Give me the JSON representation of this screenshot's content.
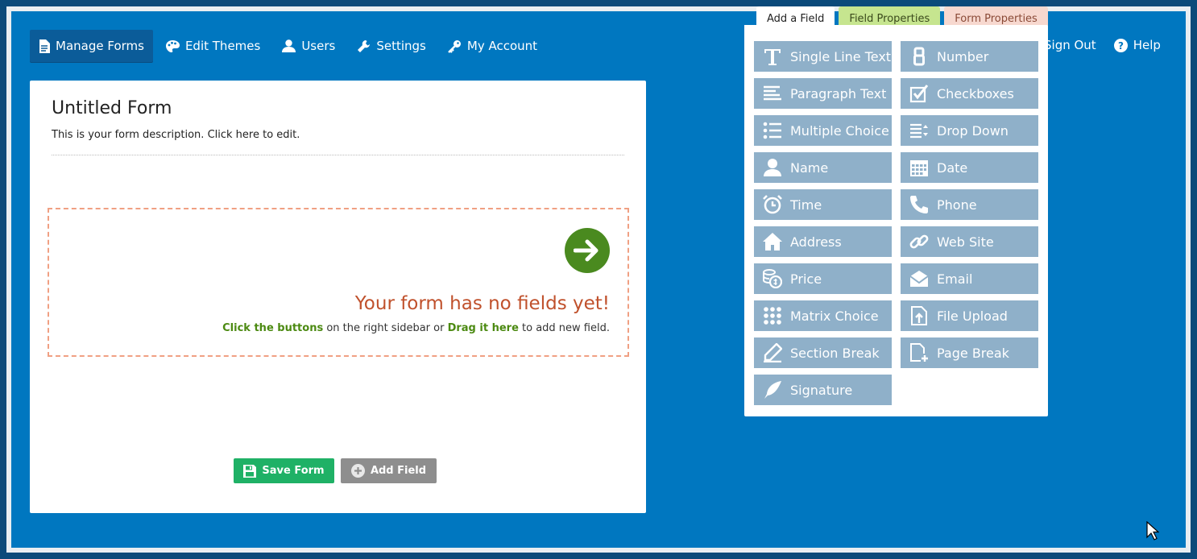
{
  "nav": {
    "items": [
      {
        "label": "Manage Forms",
        "icon": "document-icon",
        "active": true
      },
      {
        "label": "Edit Themes",
        "icon": "palette-icon"
      },
      {
        "label": "Users",
        "icon": "user-icon"
      },
      {
        "label": "Settings",
        "icon": "wrench-icon"
      },
      {
        "label": "My Account",
        "icon": "key-icon"
      }
    ],
    "sign_out": "Sign Out",
    "help": "Help"
  },
  "form": {
    "title": "Untitled Form",
    "description": "This is your form description. Click here to edit.",
    "empty_title": "Your form has no fields yet!",
    "hint_buttons": "Click the buttons",
    "hint_middle": " on the right sidebar or ",
    "hint_drag": "Drag it here",
    "hint_end": " to add new field."
  },
  "actions": {
    "save_label": "Save Form",
    "add_label": "Add Field"
  },
  "tabs": {
    "add_field": "Add a Field",
    "field_properties": "Field Properties",
    "form_properties": "Form Properties"
  },
  "fields": [
    {
      "label": "Single Line Text",
      "icon": "text-icon"
    },
    {
      "label": "Number",
      "icon": "number-icon"
    },
    {
      "label": "Paragraph Text",
      "icon": "paragraph-icon"
    },
    {
      "label": "Checkboxes",
      "icon": "checkbox-icon"
    },
    {
      "label": "Multiple Choice",
      "icon": "list-icon"
    },
    {
      "label": "Drop Down",
      "icon": "dropdown-icon"
    },
    {
      "label": "Name",
      "icon": "person-icon"
    },
    {
      "label": "Date",
      "icon": "calendar-icon"
    },
    {
      "label": "Time",
      "icon": "alarm-icon"
    },
    {
      "label": "Phone",
      "icon": "phone-icon"
    },
    {
      "label": "Address",
      "icon": "home-icon"
    },
    {
      "label": "Web Site",
      "icon": "link-icon"
    },
    {
      "label": "Price",
      "icon": "coins-icon"
    },
    {
      "label": "Email",
      "icon": "envelope-icon"
    },
    {
      "label": "Matrix Choice",
      "icon": "grid-icon"
    },
    {
      "label": "File Upload",
      "icon": "upload-icon"
    },
    {
      "label": "Section Break",
      "icon": "pencil-icon"
    },
    {
      "label": "Page Break",
      "icon": "page-add-icon"
    },
    {
      "label": "Signature",
      "icon": "feather-icon"
    }
  ],
  "colors": {
    "app_bg": "#0077c0",
    "field_button": "#8fb0c9",
    "save": "#1fb166",
    "empty_title": "#c0512c",
    "arrow_circle": "#4a8a1f"
  }
}
